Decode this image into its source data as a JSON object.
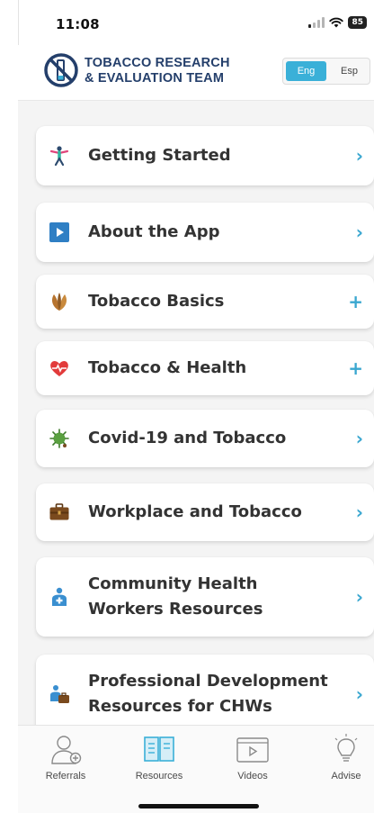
{
  "status_bar": {
    "time": "11:08",
    "battery": "85"
  },
  "header": {
    "brand_line1": "TOBACCO RESEARCH",
    "brand_line2": "& EVALUATION TEAM",
    "lang_eng": "Eng",
    "lang_esp": "Esp",
    "selected_language": "Eng"
  },
  "menu": [
    {
      "label": "Getting Started",
      "icon": "person-stretching-icon",
      "trail": "›"
    },
    {
      "label": "About the App",
      "icon": "play-icon",
      "trail": "›"
    },
    {
      "label": "Tobacco Basics",
      "icon": "tobacco-leaf-icon",
      "trail": "+"
    },
    {
      "label": "Tobacco & Health",
      "icon": "heart-pulse-icon",
      "trail": "+"
    },
    {
      "label": "Covid-19 and Tobacco",
      "icon": "virus-icon",
      "trail": "›"
    },
    {
      "label": "Workplace and Tobacco",
      "icon": "briefcase-icon",
      "trail": "›"
    },
    {
      "label": "Community Health Workers Resources",
      "icon": "health-worker-icon",
      "trail": "›"
    },
    {
      "label": "Professional Development Resources for CHWs",
      "icon": "chw-briefcase-icon",
      "trail": "›"
    }
  ],
  "tabs": [
    {
      "label": "Referrals",
      "icon": "referral-person-icon"
    },
    {
      "label": "Resources",
      "icon": "open-book-icon",
      "active": true
    },
    {
      "label": "Videos",
      "icon": "video-play-icon"
    },
    {
      "label": "Advise",
      "icon": "lightbulb-icon"
    }
  ],
  "colors": {
    "accent": "#3ab0d8",
    "brand": "#243f6b",
    "chevron": "#3aa7d0"
  }
}
